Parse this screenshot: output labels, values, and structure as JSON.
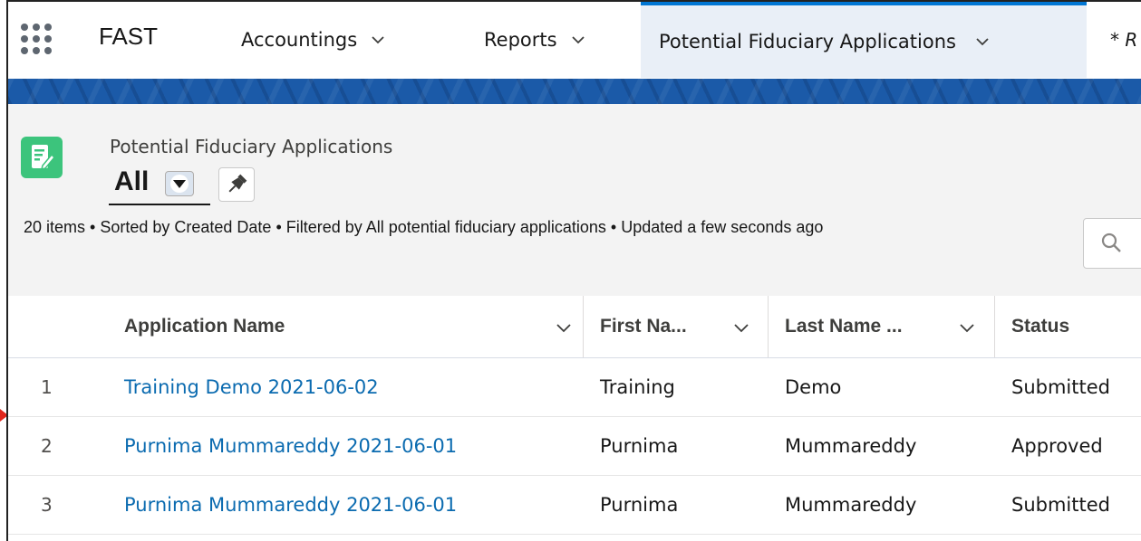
{
  "topnav": {
    "app_name": "FAST",
    "items": [
      {
        "label": "Accountings"
      },
      {
        "label": "Reports"
      },
      {
        "label": "Potential Fiduciary Applications"
      }
    ],
    "truncated_tab": "* R"
  },
  "listview": {
    "object_label": "Potential Fiduciary Applications",
    "view_name": "All",
    "info": "20 items • Sorted by Created Date • Filtered by All potential fiduciary applications • Updated a few seconds ago"
  },
  "table": {
    "columns": [
      "Application Name",
      "First Na...",
      "Last Name ...",
      "Status"
    ],
    "rows": [
      {
        "num": "1",
        "name": "Training Demo 2021-06-02",
        "first": "Training",
        "last": "Demo",
        "status": "Submitted"
      },
      {
        "num": "2",
        "name": "Purnima Mummareddy 2021-06-01",
        "first": "Purnima",
        "last": "Mummareddy",
        "status": "Approved"
      },
      {
        "num": "3",
        "name": "Purnima Mummareddy 2021-06-01",
        "first": "Purnima",
        "last": "Mummareddy",
        "status": "Submitted"
      }
    ]
  },
  "colors": {
    "accent": "#0176d3",
    "link": "#0b6bb0",
    "object_icon": "#3cc47c",
    "band": "#1b5aa8"
  },
  "icons": [
    "app-launcher-icon",
    "chevron-down-icon",
    "list-view-dropdown-icon",
    "pin-icon",
    "search-icon",
    "edit-document-icon"
  ]
}
